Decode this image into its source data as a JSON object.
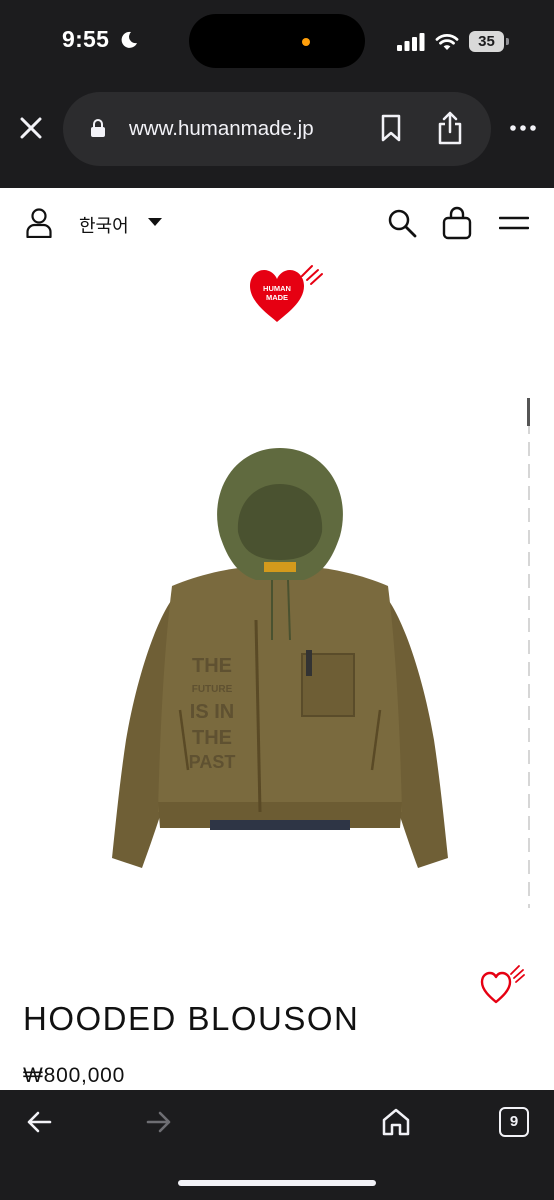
{
  "status_bar": {
    "time": "9:55",
    "battery": "35"
  },
  "browser": {
    "url": "www.humanmade.jp",
    "tab_count": "9"
  },
  "site_header": {
    "language": "한국어"
  },
  "logo": {
    "line1": "HUMAN",
    "line2": "MADE"
  },
  "product": {
    "title": "HOODED BLOUSON",
    "price": "₩800,000",
    "jacket_print": [
      "THE",
      "FUTURE",
      "IS IN",
      "THE",
      "PAST"
    ]
  },
  "colors": {
    "chrome_bg": "#1c1c1e",
    "url_bar_bg": "#2c2c2e",
    "brand_red": "#e60012",
    "jacket_olive": "#7a6a3e",
    "hood_green": "#606a3f"
  },
  "icons": {
    "close": "close-icon",
    "lock": "lock-icon",
    "bookmark": "bookmark-icon",
    "share": "share-icon",
    "more": "more-icon",
    "user": "user-icon",
    "search": "search-icon",
    "bag": "bag-icon",
    "menu": "menu-icon",
    "wishlist": "heart-icon",
    "back": "back-arrow-icon",
    "forward": "forward-arrow-icon",
    "home": "home-icon"
  }
}
